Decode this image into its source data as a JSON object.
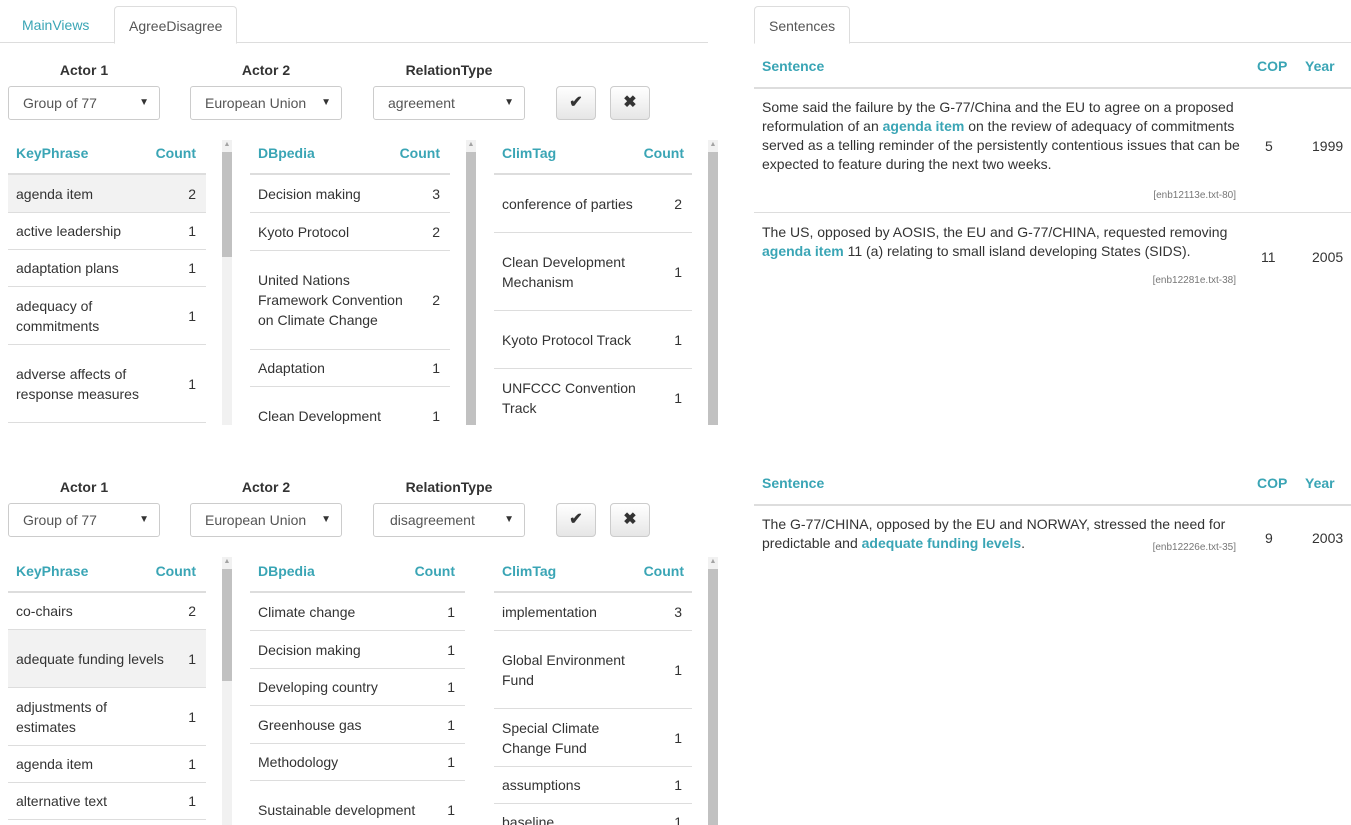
{
  "tabs": {
    "main_views": "MainViews",
    "agree_disagree": "AgreeDisagree",
    "sentences": "Sentences"
  },
  "labels": {
    "actor1": "Actor 1",
    "actor2": "Actor 2",
    "relation": "RelationType"
  },
  "icons": {
    "apply": "check-icon",
    "clear": "times-icon"
  },
  "colors": {
    "accent": "#3aa5b5",
    "text": "#333333",
    "border": "#dddddd",
    "highlight_row": "#f2f2f2"
  },
  "panel1": {
    "actor1": "Group of 77",
    "actor2": "European Union",
    "relation": "agreement",
    "keyphrase": {
      "col_name": "KeyPhrase",
      "col_count": "Count",
      "rows": [
        {
          "name": "agenda item",
          "count": "2"
        },
        {
          "name": "active leadership",
          "count": "1"
        },
        {
          "name": "adaptation plans",
          "count": "1"
        },
        {
          "name": "adequacy of commitments",
          "count": "1"
        },
        {
          "name": "adverse affects of response measures",
          "count": "1"
        }
      ]
    },
    "dbpedia": {
      "col_name": "DBpedia",
      "col_count": "Count",
      "rows": [
        {
          "name": "Decision making",
          "count": "3"
        },
        {
          "name": "Kyoto Protocol",
          "count": "2"
        },
        {
          "name": "United Nations Framework Convention on Climate Change",
          "count": "2"
        },
        {
          "name": "Adaptation",
          "count": "1"
        },
        {
          "name": "Clean Development",
          "count": "1"
        }
      ]
    },
    "climtag": {
      "col_name": "ClimTag",
      "col_count": "Count",
      "rows": [
        {
          "name": "conference of parties",
          "count": "2"
        },
        {
          "name": "Clean Development Mechanism",
          "count": "1"
        },
        {
          "name": "Kyoto Protocol Track",
          "count": "1"
        },
        {
          "name": "UNFCCC Convention Track",
          "count": "1"
        }
      ]
    },
    "sentences": {
      "col_sentence": "Sentence",
      "col_cop": "COP",
      "col_year": "Year",
      "rows": [
        {
          "pre": "Some said the failure by the G-77/China and the EU to agree on a proposed reformulation of an ",
          "hl": "agenda item",
          "post": " on the review of adequacy of commitments served as a telling reminder of the persistently contentious issues that can be expected to feature during the next two weeks.",
          "source": "[enb12113e.txt-80]",
          "cop": "5",
          "year": "1999"
        },
        {
          "pre": "The US, opposed by AOSIS, the EU and G-77/CHINA, requested removing ",
          "hl": "agenda item",
          "post": " 11 (a) relating to small island developing States (SIDS).",
          "source": "[enb12281e.txt-38]",
          "cop": "11",
          "year": "2005"
        }
      ]
    }
  },
  "panel2": {
    "actor1": "Group of 77",
    "actor2": "European Union",
    "relation": "disagreement",
    "keyphrase": {
      "col_name": "KeyPhrase",
      "col_count": "Count",
      "rows": [
        {
          "name": "co-chairs",
          "count": "2"
        },
        {
          "name": "adequate funding levels",
          "count": "1"
        },
        {
          "name": "adjustments of estimates",
          "count": "1"
        },
        {
          "name": "agenda item",
          "count": "1"
        },
        {
          "name": "alternative text",
          "count": "1"
        }
      ]
    },
    "dbpedia": {
      "col_name": "DBpedia",
      "col_count": "Count",
      "rows": [
        {
          "name": "Climate change",
          "count": "1"
        },
        {
          "name": "Decision making",
          "count": "1"
        },
        {
          "name": "Developing country",
          "count": "1"
        },
        {
          "name": "Greenhouse gas",
          "count": "1"
        },
        {
          "name": "Methodology",
          "count": "1"
        },
        {
          "name": "Sustainable development",
          "count": "1"
        }
      ]
    },
    "climtag": {
      "col_name": "ClimTag",
      "col_count": "Count",
      "rows": [
        {
          "name": "implementation",
          "count": "3"
        },
        {
          "name": "Global Environment Fund",
          "count": "1"
        },
        {
          "name": "Special Climate Change Fund",
          "count": "1"
        },
        {
          "name": "assumptions",
          "count": "1"
        },
        {
          "name": "baseline",
          "count": "1"
        }
      ]
    },
    "sentences": {
      "col_sentence": "Sentence",
      "col_cop": "COP",
      "col_year": "Year",
      "rows": [
        {
          "pre": "The G-77/CHINA, opposed by the EU and NORWAY, stressed the need for predictable and ",
          "hl": "adequate funding levels",
          "post": ".",
          "source": "[enb12226e.txt-35]",
          "cop": "9",
          "year": "2003"
        }
      ]
    }
  }
}
